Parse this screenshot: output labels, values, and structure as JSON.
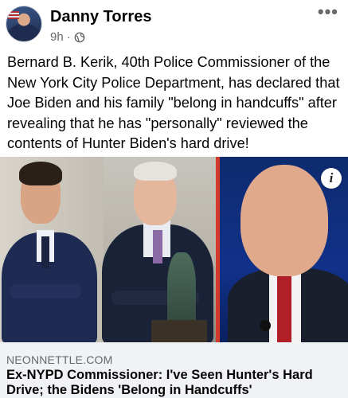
{
  "post": {
    "author": "Danny Torres",
    "time": "9h",
    "separator": "·",
    "privacy_icon": "globe-icon",
    "more_icon": "more-options-icon",
    "more_glyph": "•••",
    "text": "Bernard B. Kerik, 40th Police Commissioner of the New York City Police Department, has declared that Joe Biden and his family \"belong in handcuffs\" after revealing that he has \"personally\" reviewed the contents of Hunter Biden's hard drive!"
  },
  "link_preview": {
    "info_icon": "info-icon",
    "info_glyph": "i",
    "domain": "NEONNETTLE.COM",
    "headline": "Ex-NYPD Commissioner: I've Seen Hunter's Hard Drive; the Bidens 'Belong in Handcuffs'"
  },
  "colors": {
    "secondary_text": "#65676b",
    "link_box_bg": "#f0f2f5",
    "divider_red": "#d33a2c"
  }
}
